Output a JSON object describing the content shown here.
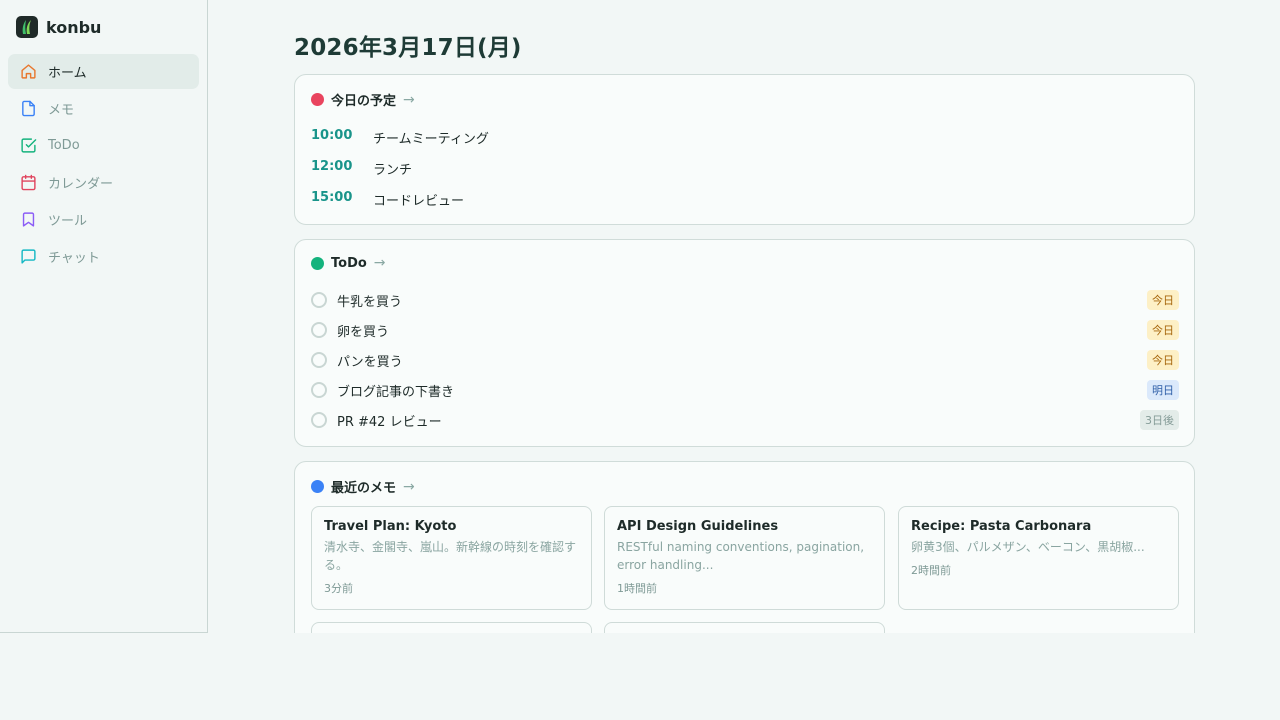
{
  "app": {
    "name": "konbu"
  },
  "nav": [
    {
      "label": "ホーム",
      "icon": "home-icon",
      "color": "#e8772e",
      "active": true
    },
    {
      "label": "メモ",
      "icon": "document-icon",
      "color": "#3b82f6"
    },
    {
      "label": "ToDo",
      "icon": "check-square-icon",
      "color": "#14b37d"
    },
    {
      "label": "カレンダー",
      "icon": "calendar-icon",
      "color": "#e0445e"
    },
    {
      "label": "ツール",
      "icon": "bookmark-icon",
      "color": "#8b5cf6"
    },
    {
      "label": "チャット",
      "icon": "chat-icon",
      "color": "#14b8c4"
    }
  ],
  "page": {
    "date_title": "2026年3月17日(月)"
  },
  "schedule": {
    "title": "今日の予定",
    "arrow": "→",
    "color": "#e9445e",
    "items": [
      {
        "time": "10:00",
        "title": "チームミーティング"
      },
      {
        "time": "12:00",
        "title": "ランチ"
      },
      {
        "time": "15:00",
        "title": "コードレビュー"
      }
    ]
  },
  "todo": {
    "title": "ToDo",
    "arrow": "→",
    "color": "#14b37d",
    "items": [
      {
        "text": "牛乳を買う",
        "badge": "今日",
        "badge_kind": "today"
      },
      {
        "text": "卵を買う",
        "badge": "今日",
        "badge_kind": "today"
      },
      {
        "text": "パンを買う",
        "badge": "今日",
        "badge_kind": "today"
      },
      {
        "text": "ブログ記事の下書き",
        "badge": "明日",
        "badge_kind": "tomorrow"
      },
      {
        "text": "PR #42 レビュー",
        "badge": "3日後",
        "badge_kind": "later"
      }
    ]
  },
  "memos": {
    "title": "最近のメモ",
    "arrow": "→",
    "color": "#3b82f6",
    "items": [
      {
        "title": "Travel Plan: Kyoto",
        "body": "清水寺、金閣寺、嵐山。新幹線の時刻を確認する。",
        "time": "3分前"
      },
      {
        "title": "API Design Guidelines",
        "body": "RESTful naming conventions, pagination, error handling...",
        "time": "1時間前"
      },
      {
        "title": "Recipe: Pasta Carbonara",
        "body": "卵黄3個、パルメザン、ベーコン、黒胡椒...",
        "time": "2時間前"
      },
      {
        "title": "",
        "body": "",
        "time": ""
      },
      {
        "title": "",
        "body": "",
        "time": ""
      }
    ]
  }
}
